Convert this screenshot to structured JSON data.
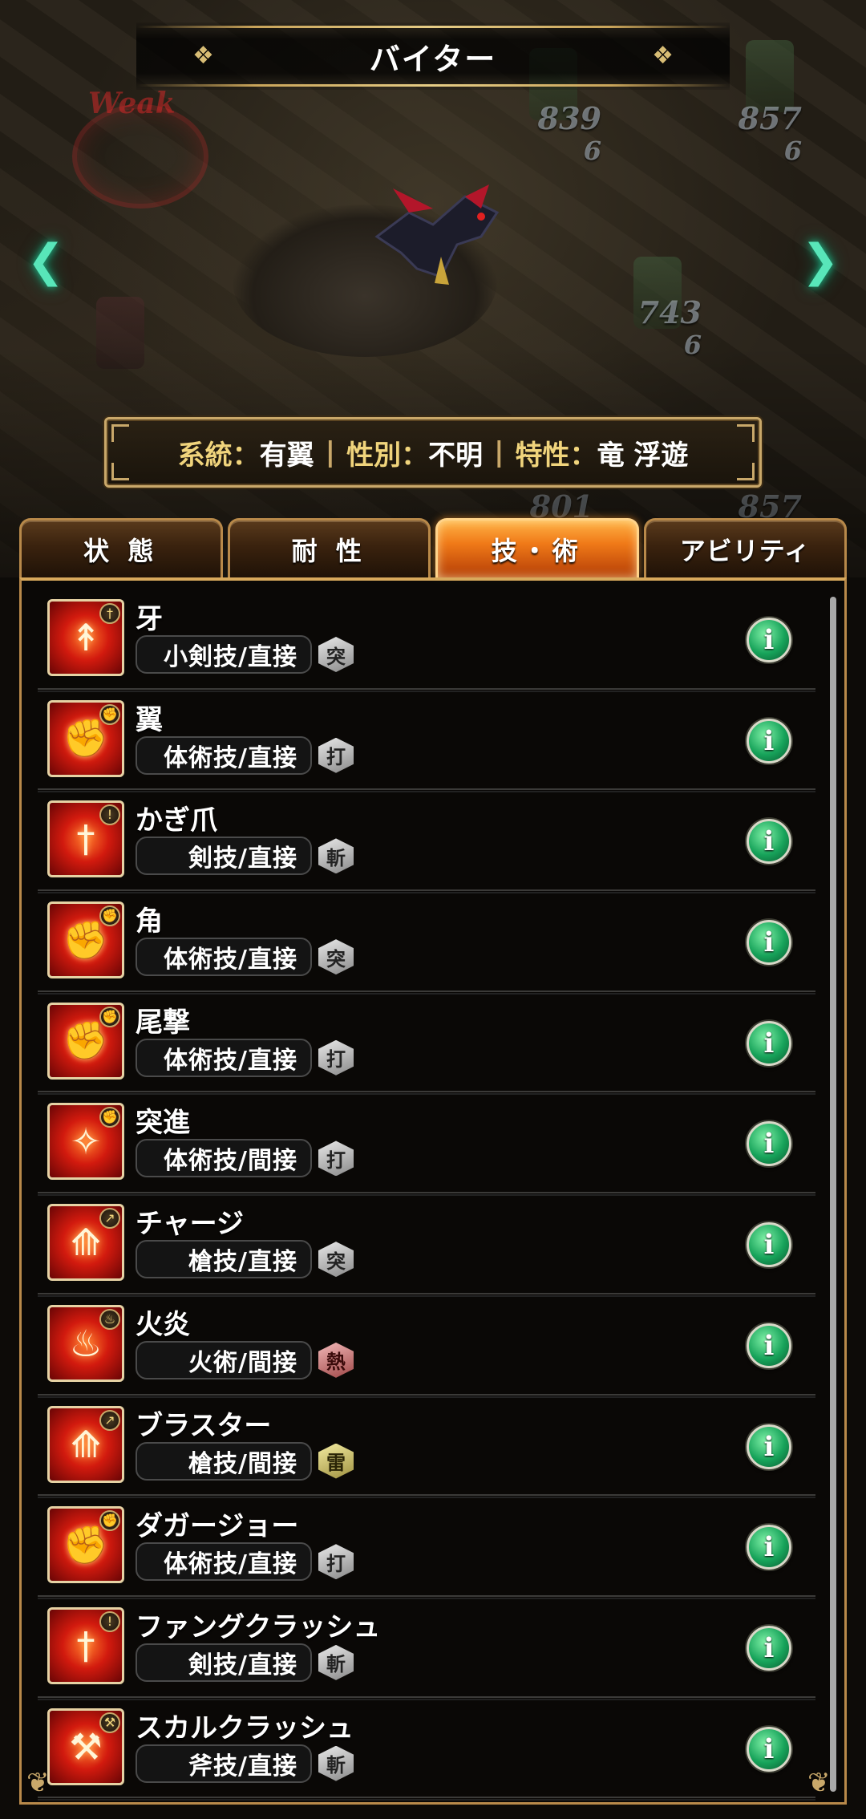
{
  "header": {
    "title": "バイター"
  },
  "scene": {
    "weak_label": "Weak",
    "party_hp": [
      {
        "hp": "839",
        "sub": "6"
      },
      {
        "hp": "857",
        "sub": "6"
      },
      {
        "hp": "743",
        "sub": "6"
      },
      {
        "hp": "801",
        "sub": ""
      },
      {
        "hp": "857",
        "sub": ""
      }
    ],
    "nav_prev_icon": "chevron-left-icon",
    "nav_next_icon": "chevron-right-icon"
  },
  "attributes": {
    "lineage_key": "系統：",
    "lineage_value": "有翼",
    "gender_key": "性別：",
    "gender_value": "不明",
    "trait_key": "特性：",
    "trait_value": "竜 浮遊"
  },
  "tabs": [
    {
      "label": "状 態",
      "active": false
    },
    {
      "label": "耐 性",
      "active": false
    },
    {
      "label": "技・術",
      "active": true
    },
    {
      "label": "アビリティ",
      "active": false
    }
  ],
  "skills": [
    {
      "name": "牙",
      "category": "小剣技/直接",
      "element": "突",
      "icon": "dagger-icon"
    },
    {
      "name": "翼",
      "category": "体術技/直接",
      "element": "打",
      "icon": "fist-icon"
    },
    {
      "name": "かぎ爪",
      "category": "剣技/直接",
      "element": "斬",
      "icon": "sword-icon"
    },
    {
      "name": "角",
      "category": "体術技/直接",
      "element": "突",
      "icon": "fist-icon"
    },
    {
      "name": "尾撃",
      "category": "体術技/直接",
      "element": "打",
      "icon": "fist-icon"
    },
    {
      "name": "突進",
      "category": "体術技/間接",
      "element": "打",
      "icon": "martial-sweep-icon"
    },
    {
      "name": "チャージ",
      "category": "槍技/直接",
      "element": "突",
      "icon": "spear-icon"
    },
    {
      "name": "火炎",
      "category": "火術/間接",
      "element": "熱",
      "icon": "fire-icon"
    },
    {
      "name": "ブラスター",
      "category": "槍技/間接",
      "element": "雷",
      "icon": "spear-icon"
    },
    {
      "name": "ダガージョー",
      "category": "体術技/直接",
      "element": "打",
      "icon": "fist-icon"
    },
    {
      "name": "ファングクラッシュ",
      "category": "剣技/直接",
      "element": "斬",
      "icon": "sword-icon"
    },
    {
      "name": "スカルクラッシュ",
      "category": "斧技/直接",
      "element": "斬",
      "icon": "axe-icon"
    }
  ],
  "colors": {
    "accent_gold": "#c9a86a",
    "active_tab": "#f07a18",
    "info_button": "#17a35a",
    "nav_arrow": "#58e6b9"
  }
}
